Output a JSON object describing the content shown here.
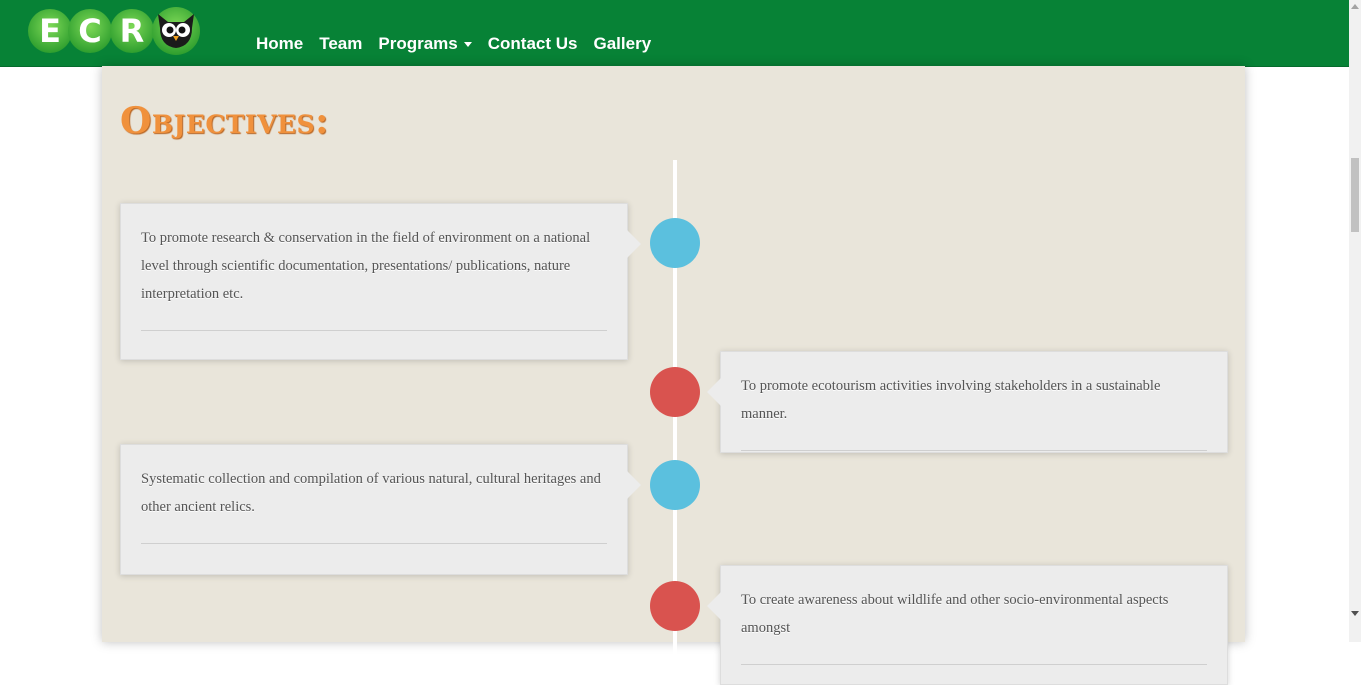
{
  "nav": {
    "logo_text": "ECRO",
    "items": [
      "Home",
      "Team",
      "Programs",
      "Contact Us",
      "Gallery"
    ]
  },
  "page": {
    "heading": "Objectives:"
  },
  "timeline": [
    {
      "side": "left",
      "color": "blue",
      "text": "To promote research & conservation in the field of environment on a national level through scientific documentation, presentations/ publications, nature interpretation etc."
    },
    {
      "side": "right",
      "color": "red",
      "text": "To promote ecotourism activities involving stakeholders in a sustainable manner."
    },
    {
      "side": "left",
      "color": "blue",
      "text": "Systematic collection and compilation of various natural, cultural heritages and other ancient relics."
    },
    {
      "side": "right",
      "color": "red",
      "text": "To create awareness about wildlife and other socio-environmental aspects amongst"
    }
  ],
  "colors": {
    "navbar": "#078236",
    "heading": "#f0913c",
    "dot_blue": "#5bc0de",
    "dot_red": "#d9534f",
    "panel": "#e9e5da"
  }
}
